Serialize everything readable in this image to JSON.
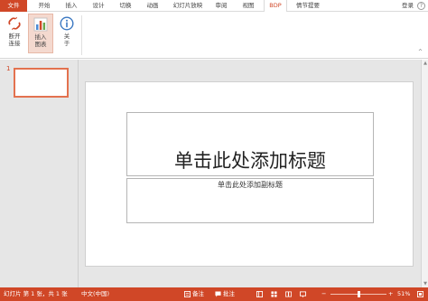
{
  "tabs": [
    {
      "id": "file",
      "label": "文件"
    },
    {
      "id": "home",
      "label": "开始"
    },
    {
      "id": "insert",
      "label": "插入"
    },
    {
      "id": "design",
      "label": "设计"
    },
    {
      "id": "transitions",
      "label": "切换"
    },
    {
      "id": "animations",
      "label": "动画"
    },
    {
      "id": "slideshow",
      "label": "幻灯片放映"
    },
    {
      "id": "review",
      "label": "审阅"
    },
    {
      "id": "view",
      "label": "视图"
    },
    {
      "id": "bdp",
      "label": "BDP"
    },
    {
      "id": "storyboard",
      "label": "情节提要"
    }
  ],
  "header": {
    "login_label": "登录",
    "help_glyph": "?"
  },
  "ribbon": {
    "disconnect_label_1": "断开",
    "disconnect_label_2": "连接",
    "insert_chart_label_1": "插入",
    "insert_chart_label_2": "图表",
    "about_label_1": "关",
    "about_label_2": "于",
    "collapse_glyph": "^"
  },
  "thumbnails": {
    "slide_number": "1"
  },
  "slide": {
    "title_placeholder": "单击此处添加标题",
    "subtitle_placeholder": "单击此处添加副标题"
  },
  "statusbar": {
    "slide_info": "幻灯片 第 1 张，共 1 张",
    "language": "中文(中国)",
    "notes_label": "备注",
    "comments_label": "批注",
    "zoom_minus": "−",
    "zoom_plus": "+",
    "zoom_level": "51%"
  },
  "colors": {
    "accent": "#d04727",
    "active_button": "#f4d9cf",
    "thumb_border": "#e3724f"
  }
}
